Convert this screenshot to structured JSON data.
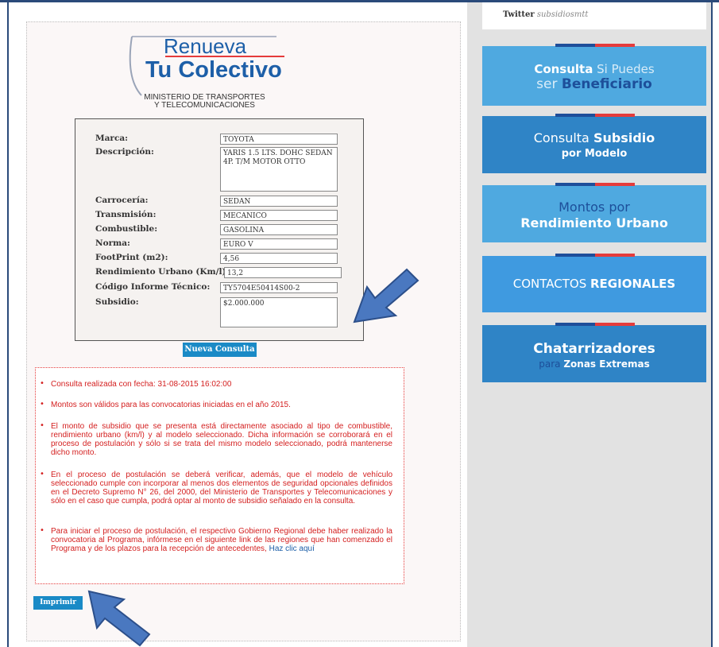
{
  "twitter": {
    "label": "Twitter",
    "handle": "subsidiosmtt"
  },
  "sidebar": {
    "buttons": [
      {
        "line1_normal": "Consulta",
        "line1_light": " Si Puedes",
        "line2_light": "ser ",
        "line2_bold": "Beneficiario"
      },
      {
        "line1_normal": "Consulta ",
        "line1_bold": "Subsidio",
        "line2": "por Modelo"
      },
      {
        "line1": "Montos por",
        "line2": "Rendimiento Urbano"
      },
      {
        "normal": "CONTACTOS ",
        "bold": "REGIONALES"
      },
      {
        "line1": "Chatarrizadores",
        "line2_light": "para ",
        "line2_bold": "Zonas Extremas"
      }
    ]
  },
  "logo": {
    "top": "Renueva",
    "main": "Tu Colectivo",
    "ministry_1": "MINISTERIO DE TRANSPORTES",
    "ministry_2": "Y TELECOMUNICACIONES"
  },
  "form": {
    "labels": {
      "marca": "Marca:",
      "descripcion": "Descripción:",
      "carroceria": "Carrocería:",
      "transmision": "Transmisión:",
      "combustible": "Combustible:",
      "norma": "Norma:",
      "footprint": "FootPrint (m2):",
      "rendimiento": "Rendimiento Urbano (Km/l):",
      "codigo": "Código Informe Técnico:",
      "subsidio": "Subsidio:"
    },
    "values": {
      "marca": "TOYOTA",
      "descripcion": "YARIS 1.5 LTS. DOHC SEDAN 4P. T/M MOTOR OTTO",
      "carroceria": "SEDAN",
      "transmision": "MECANICO",
      "combustible": "GASOLINA",
      "norma": "EURO V",
      "footprint": "4,56",
      "rendimiento": "13,2",
      "codigo": "TY5704E50414S00-2",
      "subsidio": "$2.000.000"
    }
  },
  "buttons": {
    "new_query": "Nueva Consulta",
    "print": "Imprimir"
  },
  "notes": [
    "Consulta realizada con fecha: 31-08-2015 16:02:00",
    "Montos son válidos para las convocatorias iniciadas en el año 2015.",
    "El monto de subsidio que se presenta está directamente asociado al tipo de combustible, rendimiento urbano (km/l) y al modelo seleccionado. Dicha información se corroborará en el proceso de postulación y sólo si se trata del mismo modelo seleccionado, podrá mantenerse dicho monto.",
    "En el proceso de postulación se deberá verificar, además, que el modelo de vehículo seleccionado cumple con incorporar al menos dos elementos de seguridad opcionales definidos en el Decreto Supremo N° 26, del 2000, del Ministerio de Transportes y Telecomunicaciones y sólo en el caso que cumpla, podrá optar al monto de subsidio señalado en la consulta.",
    "Para iniciar el proceso de postulación, el respectivo Gobierno Regional debe haber realizado la convocatoria al Programa, infórmese en el siguiente link de las regiones que han comenzado el Programa y de los plazos para la recepción de antecedentes,"
  ],
  "notes_link": "Haz clic aquí",
  "colors": {
    "accent_blue": "#1a8ac6",
    "btn_light": "#4fa9e0",
    "btn_dark": "#2f84c6",
    "note_red": "#d42020",
    "arrow": "#4a78c0"
  }
}
